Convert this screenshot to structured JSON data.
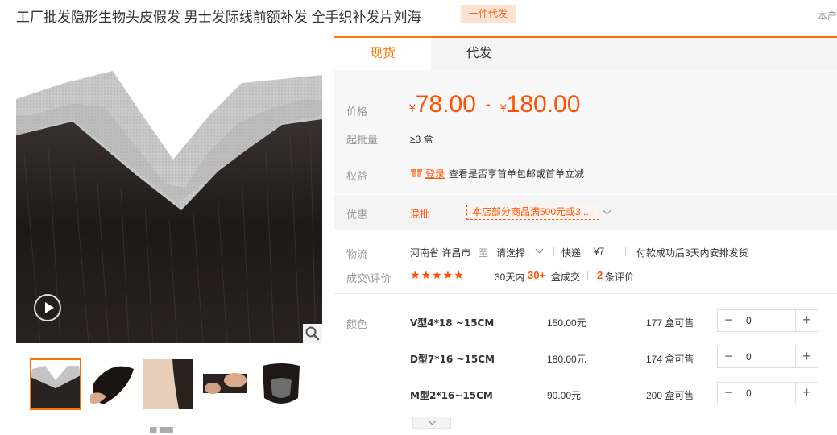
{
  "header": {
    "title": "工厂批发隐形生物头皮假发 男士发际线前额补发 全手织补发片刘海",
    "badge": "一件代发",
    "corner_text": "本产"
  },
  "tabs": [
    {
      "label": "现货",
      "active": true
    },
    {
      "label": "代发",
      "active": false
    }
  ],
  "price": {
    "label": "价格",
    "currency": "¥",
    "min": "78.00",
    "sep": "-",
    "max": "180.00"
  },
  "moq": {
    "label": "起批量",
    "value": "≥3 盒"
  },
  "rights": {
    "label": "权益",
    "login": "登录",
    "text": "查看是否享首单包邮或首单立减"
  },
  "promo": {
    "label": "优惠",
    "type": "混批",
    "tag": "本店部分商品满500元或3..."
  },
  "logistics": {
    "label": "物流",
    "origin": "河南省 许昌市",
    "to": "至",
    "dest_select": "请选择",
    "method": "快递",
    "fee": "¥7",
    "shipping_note": "付款成功后3天内安排发货"
  },
  "reviews": {
    "label": "成交\\评价",
    "stars": "★★★★★",
    "period": "30天内",
    "count": "30+",
    "unit": "盒成交",
    "review_count": "2",
    "review_unit": "条评价"
  },
  "variants": {
    "label": "颜色",
    "items": [
      {
        "name": "V型4*18 ~15CM",
        "price": "150.00元",
        "stock": "177 盒可售",
        "qty": "0"
      },
      {
        "name": "D型7*16 ~15CM",
        "price": "180.00元",
        "stock": "174 盒可售",
        "qty": "0"
      },
      {
        "name": "M型2*16~15CM",
        "price": "90.00元",
        "stock": "200 盒可售",
        "qty": "0"
      }
    ]
  },
  "icons": {
    "play": "play-icon",
    "zoom": "magnifier-icon",
    "gift": "gift-icon",
    "dropdown": "chevron-down-icon",
    "expand": "chevron-down-icon"
  },
  "colors": {
    "accent": "#ff7300",
    "price": "#ff5000",
    "badge_bg": "#fbe3d4"
  }
}
